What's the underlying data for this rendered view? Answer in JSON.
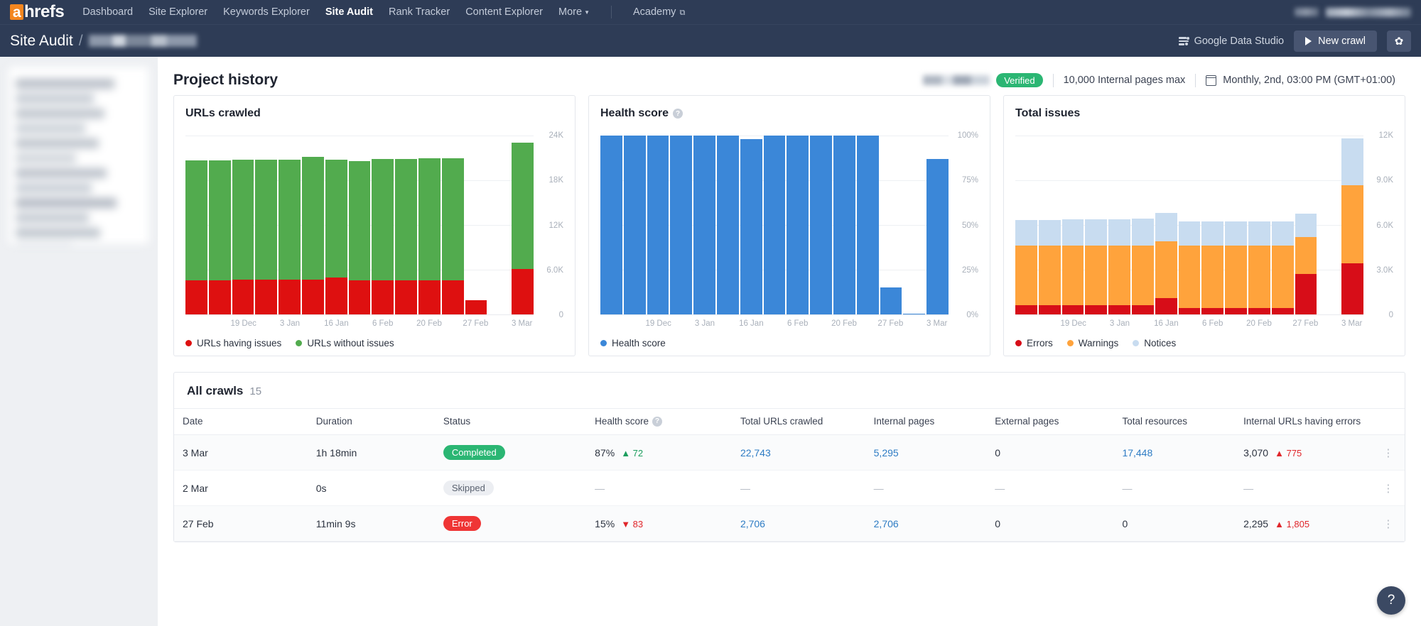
{
  "nav": {
    "logo_a": "a",
    "logo_rest": "hrefs",
    "links": [
      {
        "label": "Dashboard",
        "active": false
      },
      {
        "label": "Site Explorer",
        "active": false
      },
      {
        "label": "Keywords Explorer",
        "active": false
      },
      {
        "label": "Site Audit",
        "active": true
      },
      {
        "label": "Rank Tracker",
        "active": false
      },
      {
        "label": "Content Explorer",
        "active": false
      },
      {
        "label": "More",
        "active": false,
        "caret": true
      }
    ],
    "academy": "Academy",
    "academy_icon": "external-link-icon"
  },
  "subheader": {
    "title": "Site Audit",
    "separator": "/",
    "project_name_redacted": true,
    "google_data_studio": "Google Data Studio",
    "gds_icon": "data-studio-icon",
    "new_crawl": "New crawl",
    "play_icon": "play-icon",
    "settings_icon": "gear-icon"
  },
  "project_header": {
    "title": "Project history",
    "domain_redacted": true,
    "verified_badge": "Verified",
    "pages_max": "10,000 Internal pages max",
    "schedule_icon": "calendar-icon",
    "schedule": "Monthly, 2nd, 03:00 PM (GMT+01:00)"
  },
  "chart_data": [
    {
      "type": "bar",
      "title": "URLs crawled",
      "stacked": true,
      "xlabel": "",
      "ylabel": "",
      "ylim": [
        0,
        24000
      ],
      "yticks": [
        0,
        6000,
        12000,
        18000,
        24000
      ],
      "ytick_labels": [
        "0",
        "6.0K",
        "12K",
        "18K",
        "24K"
      ],
      "grid": true,
      "legend_position": "bottom",
      "x": [
        "",
        "",
        "19 Dec",
        "",
        "3 Jan",
        "",
        "16 Jan",
        "",
        "6 Feb",
        "",
        "20 Feb",
        "",
        "27 Feb",
        "",
        "3 Mar"
      ],
      "xtick_labels": [
        "19 Dec",
        "3 Jan",
        "16 Jan",
        "6 Feb",
        "20 Feb",
        "27 Feb",
        "3 Mar"
      ],
      "series": [
        {
          "name": "URLs having issues",
          "color": "#de1010",
          "values": [
            4600,
            4600,
            4650,
            4700,
            4650,
            4650,
            5000,
            4600,
            4600,
            4600,
            4600,
            4600,
            1900,
            0,
            6050
          ]
        },
        {
          "name": "URLs without issues",
          "color": "#52ab4e",
          "values": [
            16100,
            16100,
            16100,
            16050,
            16100,
            16500,
            15800,
            16000,
            16300,
            16300,
            16400,
            16400,
            0,
            0,
            17000
          ]
        }
      ]
    },
    {
      "type": "bar",
      "title": "Health score",
      "title_icon": "help-icon",
      "stacked": false,
      "xlabel": "",
      "ylabel": "",
      "ylim": [
        0,
        100
      ],
      "yticks": [
        0,
        25,
        50,
        75,
        100
      ],
      "ytick_labels": [
        "0%",
        "25%",
        "50%",
        "75%",
        "100%"
      ],
      "grid": true,
      "legend_position": "bottom",
      "x": [
        "",
        "",
        "19 Dec",
        "",
        "3 Jan",
        "",
        "16 Jan",
        "",
        "6 Feb",
        "",
        "20 Feb",
        "",
        "27 Feb",
        "",
        "3 Mar"
      ],
      "xtick_labels": [
        "19 Dec",
        "3 Jan",
        "16 Jan",
        "6 Feb",
        "20 Feb",
        "27 Feb",
        "3 Mar"
      ],
      "series": [
        {
          "name": "Health score",
          "color": "#3b87d8",
          "values": [
            100,
            100,
            100,
            100,
            100,
            100,
            98,
            100,
            100,
            101,
            101,
            101,
            15,
            0.5,
            87
          ]
        }
      ]
    },
    {
      "type": "bar",
      "title": "Total issues",
      "stacked": true,
      "xlabel": "",
      "ylabel": "",
      "ylim": [
        0,
        12000
      ],
      "yticks": [
        0,
        3000,
        6000,
        9000,
        12000
      ],
      "ytick_labels": [
        "0",
        "3.0K",
        "6.0K",
        "9.0K",
        "12K"
      ],
      "grid": true,
      "legend_position": "bottom",
      "x": [
        "",
        "",
        "19 Dec",
        "",
        "3 Jan",
        "",
        "16 Jan",
        "",
        "6 Feb",
        "",
        "20 Feb",
        "",
        "27 Feb",
        "",
        "3 Mar"
      ],
      "xtick_labels": [
        "19 Dec",
        "3 Jan",
        "16 Jan",
        "6 Feb",
        "20 Feb",
        "27 Feb",
        "3 Mar"
      ],
      "series": [
        {
          "name": "Errors",
          "color": "#d70d18",
          "values": [
            610,
            610,
            610,
            610,
            600,
            600,
            1100,
            450,
            450,
            450,
            450,
            440,
            2700,
            0,
            3420
          ]
        },
        {
          "name": "Warnings",
          "color": "#ffa33c",
          "values": [
            3990,
            3990,
            3990,
            3990,
            4000,
            4000,
            3820,
            4150,
            4150,
            4150,
            4150,
            4160,
            2500,
            0,
            5230
          ]
        },
        {
          "name": "Notices",
          "color": "#c8dcf0",
          "values": [
            1750,
            1750,
            1760,
            1780,
            1800,
            1820,
            1870,
            1640,
            1640,
            1650,
            1650,
            1650,
            1560,
            0,
            3150
          ]
        }
      ]
    }
  ],
  "table": {
    "title": "All crawls",
    "count": "15",
    "columns": [
      {
        "label": "Date",
        "icon": null
      },
      {
        "label": "Duration",
        "icon": null
      },
      {
        "label": "Status",
        "icon": null
      },
      {
        "label": "Health score",
        "icon": "help-icon"
      },
      {
        "label": "Total URLs crawled",
        "icon": null
      },
      {
        "label": "Internal pages",
        "icon": null
      },
      {
        "label": "External pages",
        "icon": null
      },
      {
        "label": "Total resources",
        "icon": null
      },
      {
        "label": "Internal URLs having errors",
        "icon": null
      },
      {
        "label": "",
        "icon": null
      }
    ],
    "rows": [
      {
        "date": "3 Mar",
        "duration": "1h 18min",
        "status": {
          "label": "Completed",
          "kind": "completed"
        },
        "health_score": "87%",
        "health_delta": {
          "value": "72",
          "dir": "up",
          "tone": "good"
        },
        "total_urls": {
          "value": "22,743",
          "link": true
        },
        "internal_pages": {
          "value": "5,295",
          "link": true
        },
        "external_pages": {
          "value": "0",
          "link": false
        },
        "total_resources": {
          "value": "17,448",
          "link": true
        },
        "internal_errors": "3,070",
        "internal_errors_delta": {
          "value": "775",
          "dir": "up",
          "tone": "bad"
        },
        "menu_icon": "kebab-menu-icon"
      },
      {
        "date": "2 Mar",
        "duration": "0s",
        "status": {
          "label": "Skipped",
          "kind": "skipped"
        },
        "health_score": "—",
        "health_delta": null,
        "total_urls": {
          "value": "—",
          "link": false
        },
        "internal_pages": {
          "value": "—",
          "link": false
        },
        "external_pages": {
          "value": "—",
          "link": false
        },
        "total_resources": {
          "value": "—",
          "link": false
        },
        "internal_errors": "—",
        "internal_errors_delta": null,
        "menu_icon": "kebab-menu-icon"
      },
      {
        "date": "27 Feb",
        "duration": "11min 9s",
        "status": {
          "label": "Error",
          "kind": "error"
        },
        "health_score": "15%",
        "health_delta": {
          "value": "83",
          "dir": "down",
          "tone": "bad"
        },
        "total_urls": {
          "value": "2,706",
          "link": true
        },
        "internal_pages": {
          "value": "2,706",
          "link": true
        },
        "external_pages": {
          "value": "0",
          "link": false
        },
        "total_resources": {
          "value": "0",
          "link": false
        },
        "internal_errors": "2,295",
        "internal_errors_delta": {
          "value": "1,805",
          "dir": "up",
          "tone": "bad"
        },
        "menu_icon": "kebab-menu-icon"
      }
    ]
  },
  "help_fab": "?"
}
